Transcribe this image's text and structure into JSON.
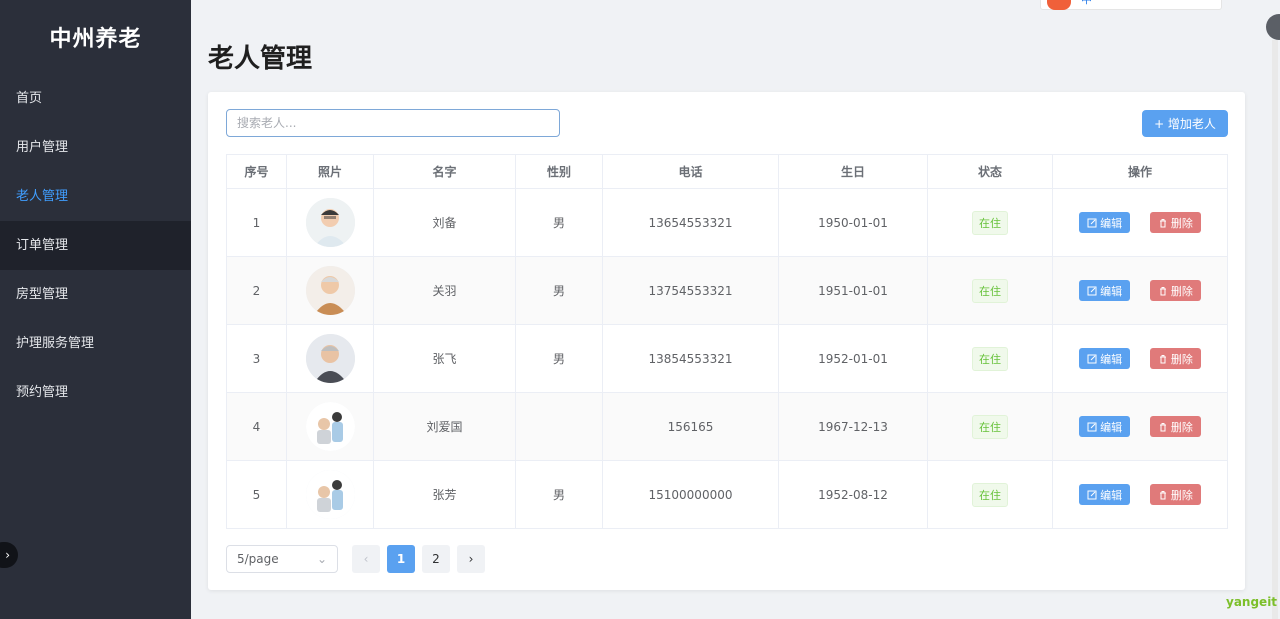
{
  "app": {
    "brand": "中州养老"
  },
  "sidebar": {
    "items": [
      {
        "label": "首页"
      },
      {
        "label": "用户管理"
      },
      {
        "label": "老人管理"
      },
      {
        "label": "订单管理"
      },
      {
        "label": "房型管理"
      },
      {
        "label": "护理服务管理"
      },
      {
        "label": "预约管理"
      }
    ],
    "active_item": "老人管理"
  },
  "page": {
    "title": "老人管理"
  },
  "toolbar": {
    "search_placeholder": "搜索老人...",
    "add_label": "+ 增加老人"
  },
  "table": {
    "columns": [
      "序号",
      "照片",
      "名字",
      "性别",
      "电话",
      "生日",
      "状态",
      "操作"
    ],
    "rows": [
      {
        "index": "1",
        "name": "刘备",
        "gender": "男",
        "phone": "13654553321",
        "birthday": "1950-01-01",
        "status": "在住"
      },
      {
        "index": "2",
        "name": "关羽",
        "gender": "男",
        "phone": "13754553321",
        "birthday": "1951-01-01",
        "status": "在住"
      },
      {
        "index": "3",
        "name": "张飞",
        "gender": "男",
        "phone": "13854553321",
        "birthday": "1952-01-01",
        "status": "在住"
      },
      {
        "index": "4",
        "name": "刘爱国",
        "gender": "",
        "phone": "156165",
        "birthday": "1967-12-13",
        "status": "在住"
      },
      {
        "index": "5",
        "name": "张芳",
        "gender": "男",
        "phone": "15100000000",
        "birthday": "1952-08-12",
        "status": "在住"
      }
    ],
    "edit_label": "编辑",
    "delete_label": "删除"
  },
  "pagination": {
    "page_size": "5/page",
    "pages": [
      "1",
      "2"
    ],
    "current": "1"
  },
  "ime": {
    "label": "中"
  },
  "watermark": "yangeit",
  "colors": {
    "sidebar_bg": "#2b2f3a",
    "accent": "#409eff",
    "primary_button": "#5aa1f0",
    "danger_button": "#e07a7a",
    "status_green": "#67c23a"
  },
  "icons": {
    "edit": "edit-icon",
    "delete": "trash-icon",
    "select": "chevron-down-icon",
    "prev": "chevron-left-icon",
    "next": "chevron-right-icon",
    "collapse": "chevron-right-icon"
  }
}
